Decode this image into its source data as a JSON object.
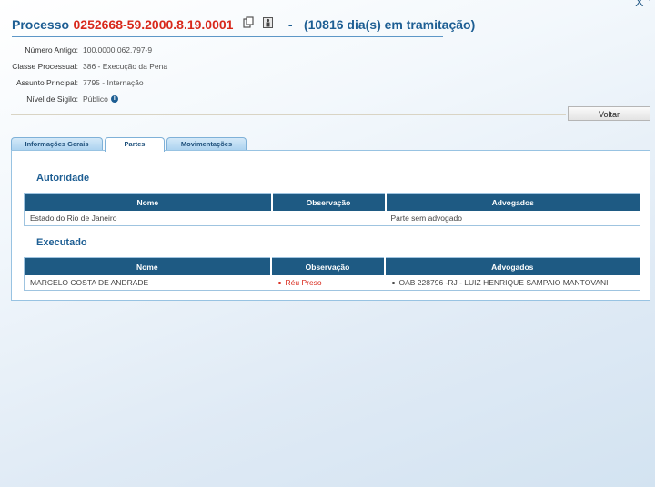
{
  "header": {
    "label": "Processo",
    "number": "0252668-59.2000.8.19.0001",
    "separator": "-",
    "days": "(10816 dia(s) em tramitação)",
    "close_glyph": "X",
    "close_extra": "+"
  },
  "info": [
    {
      "label": "Número Antigo:",
      "value": "100.0000.062.797-9"
    },
    {
      "label": "Classe Processual:",
      "value": "386 - Execução da Pena"
    },
    {
      "label": "Assunto Principal:",
      "value": "7795 - Internação"
    },
    {
      "label": "Nível de Sigilo:",
      "value": "Público"
    }
  ],
  "voltar_label": "Voltar",
  "tabs": [
    {
      "label": "Informações Gerais"
    },
    {
      "label": "Partes"
    },
    {
      "label": "Movimentações"
    }
  ],
  "icons": {
    "copy": "copy-icon",
    "person": "person-icon",
    "info": "info-icon"
  },
  "autoridade": {
    "title": "Autoridade",
    "columns": [
      "Nome",
      "Observação",
      "Advogados"
    ],
    "rows": [
      {
        "nome": "Estado do Rio de Janeiro",
        "observacao": "",
        "advogados": "Parte sem advogado"
      }
    ]
  },
  "executado": {
    "title": "Executado",
    "columns": [
      "Nome",
      "Observação",
      "Advogados"
    ],
    "rows": [
      {
        "nome": "MARCELO COSTA DE ANDRADE",
        "observacao": "Réu Preso",
        "advogados": "OAB 228796 -RJ - LUIZ HENRIQUE SAMPAIO MANTOVANI"
      }
    ]
  },
  "colors": {
    "accent": "#1d5e93",
    "header_bg": "#1e5a83",
    "number_red": "#d8281b"
  }
}
